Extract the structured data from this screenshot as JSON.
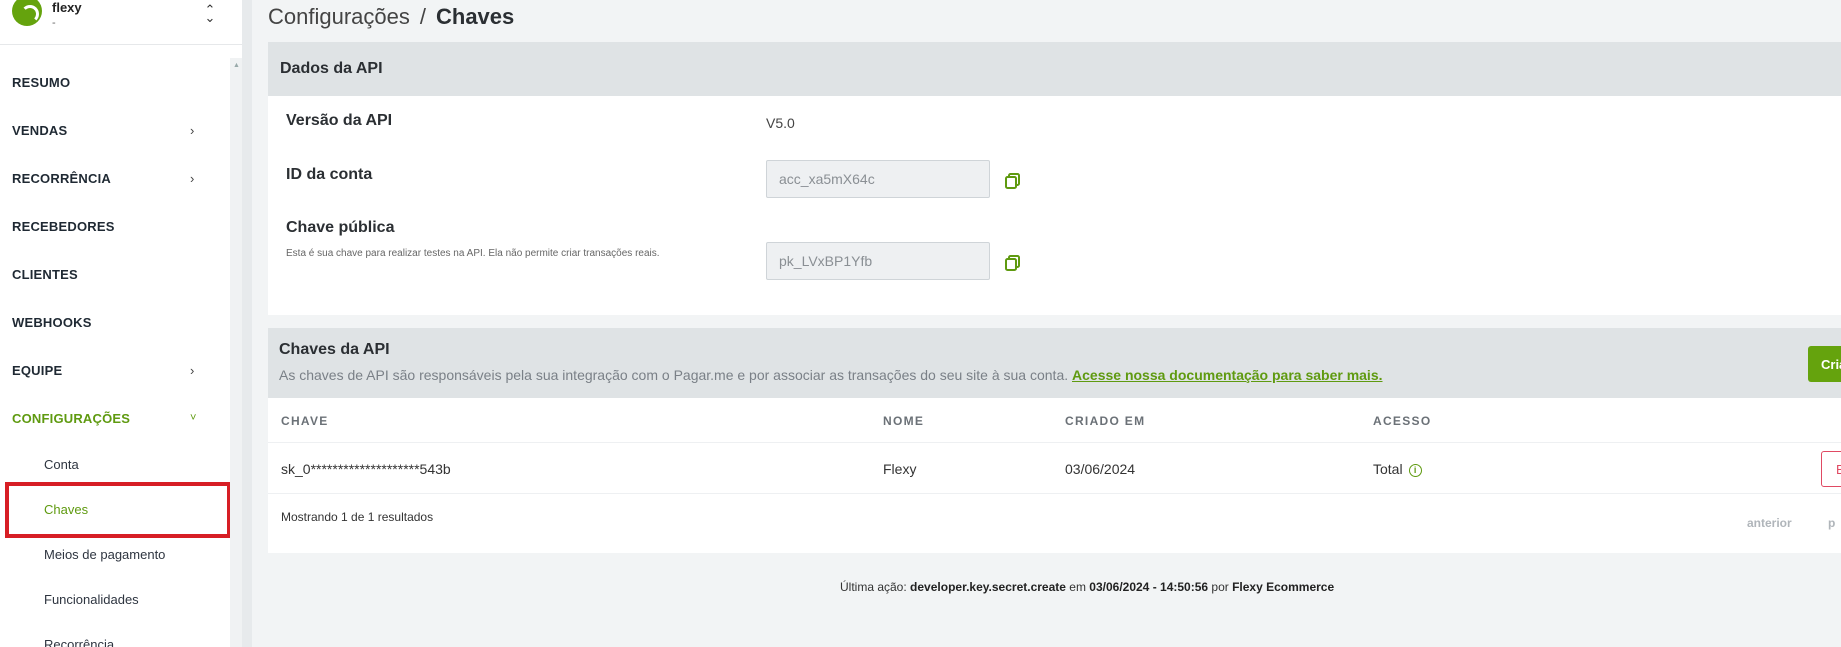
{
  "account": {
    "name": "flexy",
    "subtitle": "-",
    "switch_icon": "up-down-chevron-icon"
  },
  "sidebar": {
    "items": [
      {
        "label": "RESUMO",
        "chevron": ""
      },
      {
        "label": "VENDAS",
        "chevron": "›"
      },
      {
        "label": "RECORRÊNCIA",
        "chevron": "›"
      },
      {
        "label": "RECEBEDORES",
        "chevron": ""
      },
      {
        "label": "CLIENTES",
        "chevron": ""
      },
      {
        "label": "WEBHOOKS",
        "chevron": ""
      },
      {
        "label": "EQUIPE",
        "chevron": "›"
      },
      {
        "label": "CONFIGURAÇÕES",
        "chevron": "˅"
      }
    ],
    "subitems": [
      {
        "label": "Conta"
      },
      {
        "label": "Chaves"
      },
      {
        "label": "Meios de pagamento"
      },
      {
        "label": "Funcionalidades"
      },
      {
        "label": "Recorrência"
      }
    ]
  },
  "breadcrumb": {
    "parent": "Configurações",
    "separator": "/",
    "current": "Chaves"
  },
  "api_data": {
    "title": "Dados da API",
    "version_label": "Versão da API",
    "version_value": "V5.0",
    "account_id_label": "ID da conta",
    "account_id_value": "acc_xa5mX64c",
    "public_key_label": "Chave pública",
    "public_key_hint": "Esta é sua chave para realizar testes na API. Ela não permite criar transações reais.",
    "public_key_value": "pk_LVxBP1Yfb"
  },
  "api_keys": {
    "title": "Chaves da API",
    "description": "As chaves de API são responsáveis pela sua integração com o Pagar.me e por associar as transações do seu site à sua conta.",
    "doc_link": "Acesse nossa documentação para saber mais.",
    "create_button": "Criar",
    "columns": [
      "CHAVE",
      "NOME",
      "CRIADO EM",
      "ACESSO"
    ],
    "rows": [
      {
        "key": "sk_0********************543b",
        "name": "Flexy",
        "created": "03/06/2024",
        "access": "Total",
        "action": "E"
      }
    ],
    "showing": "Mostrando 1 de 1 resultados",
    "prev": "anterior",
    "next": "p"
  },
  "last_action": {
    "prefix": "Última ação:",
    "action": "developer.key.secret.create",
    "on": "em",
    "datetime": "03/06/2024 - 14:50:56",
    "by": "por",
    "user": "Flexy Ecommerce"
  },
  "colors": {
    "accent": "#65a30d",
    "danger": "#e04a63",
    "highlight": "#d71e25"
  }
}
